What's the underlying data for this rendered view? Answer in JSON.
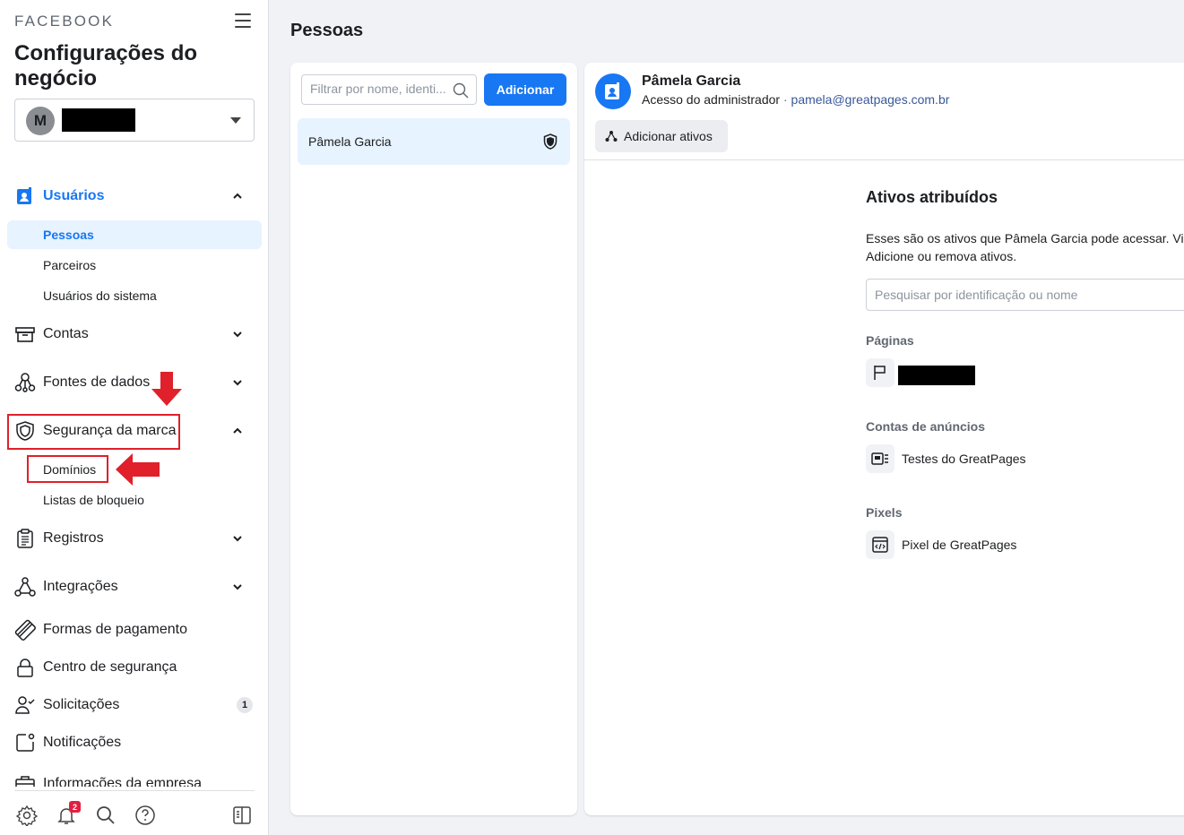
{
  "sidebar": {
    "brand": "FACEBOOK",
    "title": "Configurações do negócio",
    "account_initial": "M",
    "nav": {
      "users": "Usuários",
      "people": "Pessoas",
      "partners": "Parceiros",
      "system_users": "Usuários do sistema",
      "accounts": "Contas",
      "data_sources": "Fontes de dados",
      "brand_safety": "Segurança da marca",
      "domains": "Domínios",
      "block_lists": "Listas de bloqueio",
      "registrations": "Registros",
      "integrations": "Integrações",
      "payment_methods": "Formas de pagamento",
      "security_center": "Centro de segurança",
      "requests": "Solicitações",
      "requests_count": "1",
      "notifications": "Notificações",
      "business_info": "Informações da empresa"
    },
    "notif_badge": "2"
  },
  "main": {
    "title": "Pessoas",
    "filter_placeholder": "Filtrar por nome, identi...",
    "add_button": "Adicionar",
    "people": [
      {
        "name": "Pâmela Garcia"
      }
    ]
  },
  "detail": {
    "name": "Pâmela Garcia",
    "role": "Acesso do administrador",
    "separator": " · ",
    "email": "pamela@greatpages.com.br",
    "add_assets": "Adicionar ativos",
    "assigned_title": "Ativos atribuídos",
    "desc_line1": "Esses são os ativos que Pâmela Garcia pode acessar. Vis",
    "desc_line2": "Adicione ou remova ativos.",
    "search_placeholder": "Pesquisar por identificação ou nome",
    "pages_label": "Páginas",
    "ad_accounts_label": "Contas de anúncios",
    "ad_account_name": "Testes do GreatPages",
    "pixels_label": "Pixels",
    "pixel_name": "Pixel de GreatPages"
  },
  "colors": {
    "accent": "#1877f2",
    "highlight": "#e0202a"
  }
}
